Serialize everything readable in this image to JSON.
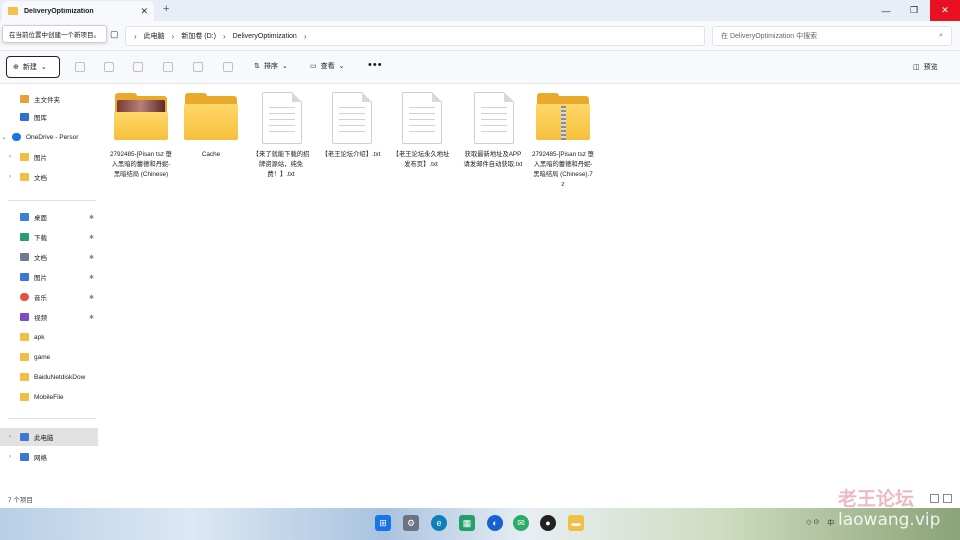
{
  "window": {
    "tab_title": "DeliveryOptimization",
    "tab_close": "✕",
    "new_tab": "+",
    "minimize": "—",
    "maximize": "❐",
    "close": "✕"
  },
  "address": {
    "tooltip": "在当前位置中创建一个新项目。",
    "crumbs": [
      "此电脑",
      "新加卷 (D:)",
      "DeliveryOptimization"
    ],
    "search_placeholder": "在 DeliveryOptimization 中搜索"
  },
  "toolbar": {
    "new_label": "新建",
    "sort_label": "排序",
    "view_label": "查看",
    "more": "•••",
    "preview_label": "预览"
  },
  "sidebar": {
    "items": [
      {
        "label": "主文件夹",
        "icon": "home-icon",
        "color": "#e8a13a"
      },
      {
        "label": "图库",
        "icon": "gallery-icon",
        "color": "#2f6fd0"
      },
      {
        "label": "OneDrive - Persor",
        "icon": "onedrive-icon",
        "color": "#1a73e8"
      },
      {
        "label": "图片",
        "icon": "folder-icon",
        "color": "#f2bf45"
      },
      {
        "label": "文档",
        "icon": "folder-icon",
        "color": "#f2bf45"
      },
      {
        "label": "桌面",
        "icon": "desktop-icon",
        "color": "#3c7fd8"
      },
      {
        "label": "下载",
        "icon": "download-icon",
        "color": "#2a9d6f"
      },
      {
        "label": "文档",
        "icon": "documents-icon",
        "color": "#6d7c8f"
      },
      {
        "label": "图片",
        "icon": "pictures-icon",
        "color": "#3b78d6"
      },
      {
        "label": "音乐",
        "icon": "music-icon",
        "color": "#e0533f"
      },
      {
        "label": "视频",
        "icon": "video-icon",
        "color": "#7a4cc9"
      },
      {
        "label": "apk",
        "icon": "folder-icon",
        "color": "#f2bf45"
      },
      {
        "label": "game",
        "icon": "folder-icon",
        "color": "#f2bf45"
      },
      {
        "label": "BaiduNetdiskDow",
        "icon": "folder-icon",
        "color": "#f2bf45"
      },
      {
        "label": "MobileFile",
        "icon": "folder-icon",
        "color": "#f2bf45"
      },
      {
        "label": "此电脑",
        "icon": "computer-icon",
        "color": "#3b78d6"
      },
      {
        "label": "网络",
        "icon": "network-icon",
        "color": "#3b78d6"
      }
    ]
  },
  "files": [
    {
      "name": "2792485-[Pisan tsz 堕入黑暗的蕾德和丹妮-黑暗结局 (Chinese)",
      "type": "image-folder"
    },
    {
      "name": "Cache",
      "type": "folder"
    },
    {
      "name": "【来了就能下载的招牌资源站，纯免费！】.txt",
      "type": "txt"
    },
    {
      "name": "【老王论坛介绍】.txt",
      "type": "txt"
    },
    {
      "name": "【老王论坛永久地址发布页】.txt",
      "type": "txt"
    },
    {
      "name": "获取最新地址及APP请发邮件自动获取.txt",
      "type": "txt"
    },
    {
      "name": "2792485-[Pisan tsz 堕入黑暗的蕾德和丹妮-黑暗结局 (Chinese).7z",
      "type": "zip"
    }
  ],
  "status": {
    "item_count": "7 个项目"
  },
  "taskbar": {
    "apps": [
      {
        "name": "start-icon",
        "color": "#1a73e8",
        "glyph": "⊞"
      },
      {
        "name": "settings-icon",
        "color": "#6b7280",
        "glyph": "⚙"
      },
      {
        "name": "edge-icon",
        "color": "#0f7fb8",
        "glyph": "e"
      },
      {
        "name": "store-icon",
        "color": "#22a06b",
        "glyph": "▦"
      },
      {
        "name": "app-icon",
        "color": "#1a5fd0",
        "glyph": "◐"
      },
      {
        "name": "wechat-icon",
        "color": "#2aae67",
        "glyph": "✉"
      },
      {
        "name": "qq-icon",
        "color": "#222",
        "glyph": "●"
      },
      {
        "name": "explorer-icon",
        "color": "#f2bf45",
        "glyph": "▬"
      }
    ],
    "tray_ime": "中",
    "tray_icons": "◇ ⊙"
  },
  "watermark": {
    "line1": "老王论坛",
    "line2": "laowang.vip"
  }
}
